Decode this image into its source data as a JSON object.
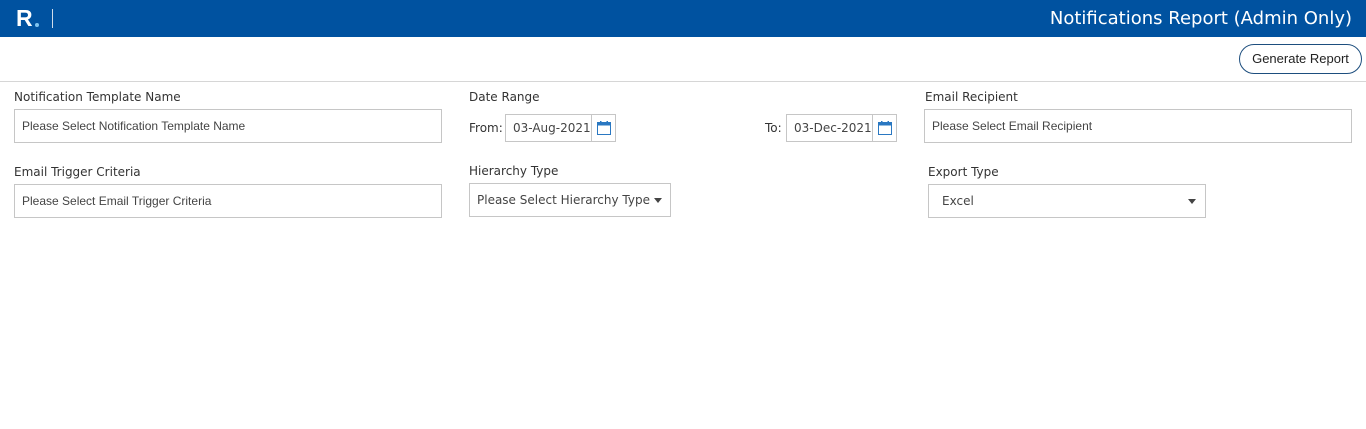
{
  "header": {
    "logo_text": "R",
    "title": "Notifications Report (Admin Only)"
  },
  "toolbar": {
    "generate_label": "Generate Report"
  },
  "filters": {
    "template": {
      "label": "Notification Template Name",
      "placeholder": "Please Select Notification Template Name"
    },
    "date_range": {
      "label": "Date Range",
      "from_label": "From:",
      "from_value": "03-Aug-2021",
      "to_label": "To:",
      "to_value": "03-Dec-2021"
    },
    "recipient": {
      "label": "Email Recipient",
      "placeholder": "Please Select Email Recipient"
    },
    "trigger": {
      "label": "Email Trigger Criteria",
      "placeholder": "Please Select Email Trigger Criteria"
    },
    "hierarchy": {
      "label": "Hierarchy Type",
      "selected": "Please Select Hierarchy Type"
    },
    "export": {
      "label": "Export Type",
      "selected": "Excel"
    }
  },
  "colors": {
    "header_bg": "#0052a0",
    "calendar_icon": "#2a78c2"
  }
}
